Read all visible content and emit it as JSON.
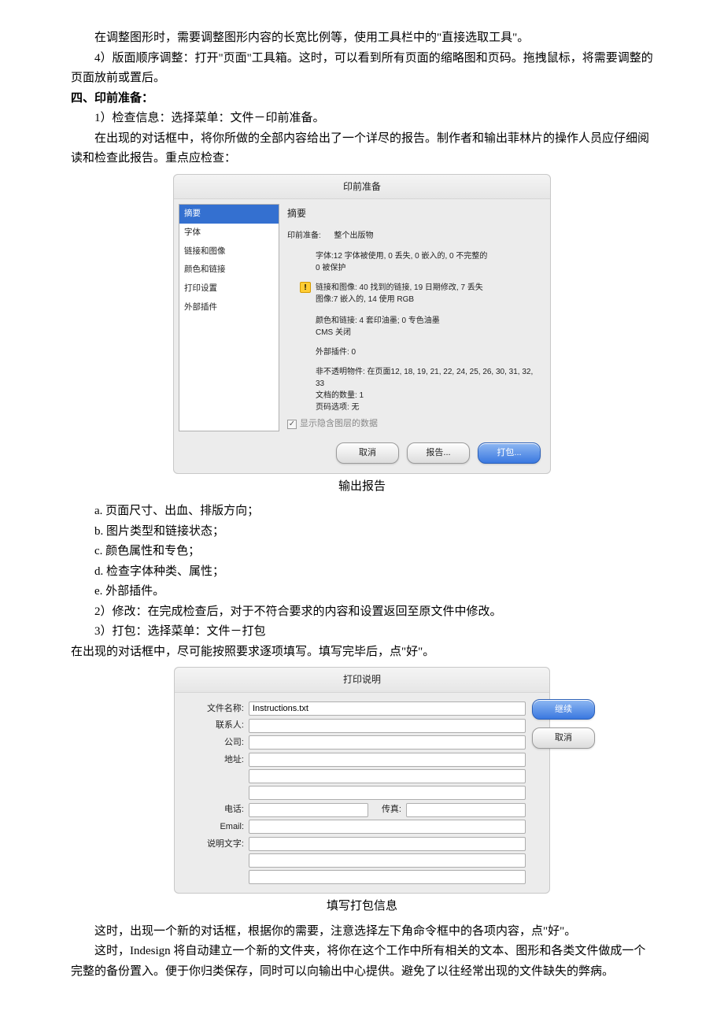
{
  "paragraphs": {
    "p1": "在调整图形时，需要调整图形内容的长宽比例等，使用工具栏中的\"直接选取工具\"。",
    "p2": "4）版面顺序调整：打开\"页面\"工具箱。这时，可以看到所有页面的缩略图和页码。拖拽鼠标，将需要调整的页面放前或置后。",
    "h1": "四、印前准备：",
    "p3": "1）检查信息：选择菜单：文件－印前准备。",
    "p4": "在出现的对话框中，将你所做的全部内容给出了一个详尽的报告。制作者和输出菲林片的操作人员应仔细阅读和检查此报告。重点应检查：",
    "caption1": "输出报告",
    "la": "a. 页面尺寸、出血、排版方向；",
    "lb": "b. 图片类型和链接状态；",
    "lc": "c. 颜色属性和专色；",
    "ld": "d. 检查字体种类、属性；",
    "le": "e. 外部插件。",
    "p5": "2）修改：在完成检查后，对于不符合要求的内容和设置返回至原文件中修改。",
    "p6": "3）打包：选择菜单：文件－打包",
    "p7": "在出现的对话框中，尽可能按照要求逐项填写。填写完毕后，点\"好\"。",
    "caption2": "填写打包信息",
    "p8": "这时，出现一个新的对话框，根据你的需要，注意选择左下角命令框中的各项内容，点\"好\"。",
    "p9": "这时，Indesign 将自动建立一个新的文件夹，将你在这个工作中所有相关的文本、图形和各类文件做成一个完整的备份置入。便于你归类保存，同时可以向输出中心提供。避免了以往经常出现的文件缺失的弊病。"
  },
  "dialog1": {
    "title": "印前准备",
    "nav": [
      "摘要",
      "字体",
      "链接和图像",
      "颜色和链接",
      "打印设置",
      "外部插件"
    ],
    "main_heading": "摘要",
    "scope_label": "印前准备:",
    "scope_value": "整个出版物",
    "line_fonts": "字体:12 字体被使用, 0 丢失, 0 嵌入的, 0 不完整的",
    "line_fonts2": "0 被保护",
    "line_links1": "链接和图像: 40 找到的链接, 19 日期修改, 7 丢失",
    "line_links2": "图像:7 嵌入的, 14 使用 RGB",
    "line_colors1": "颜色和链接: 4 套印油墨; 0 专色油墨",
    "line_colors2": "CMS 关闭",
    "line_plugins": "外部插件: 0",
    "line_opaque1": "非不透明物件: 在页面12, 18, 19, 21, 22, 24, 25, 26, 30, 31, 32, 33",
    "line_opaque2": "文档的数量: 1",
    "line_opaque3": "页码选项: 无",
    "checkbox": "显示隐含图层的数据",
    "btn_cancel": "取消",
    "btn_report": "报告...",
    "btn_pack": "打包..."
  },
  "dialog2": {
    "title": "打印说明",
    "labels": {
      "filename": "文件名称:",
      "contact": "联系人:",
      "company": "公司:",
      "address": "地址:",
      "phone": "电话:",
      "fax": "传真:",
      "email": "Email:",
      "desc": "说明文字:"
    },
    "filename_value": "Instructions.txt",
    "btn_continue": "继续",
    "btn_cancel": "取消"
  }
}
